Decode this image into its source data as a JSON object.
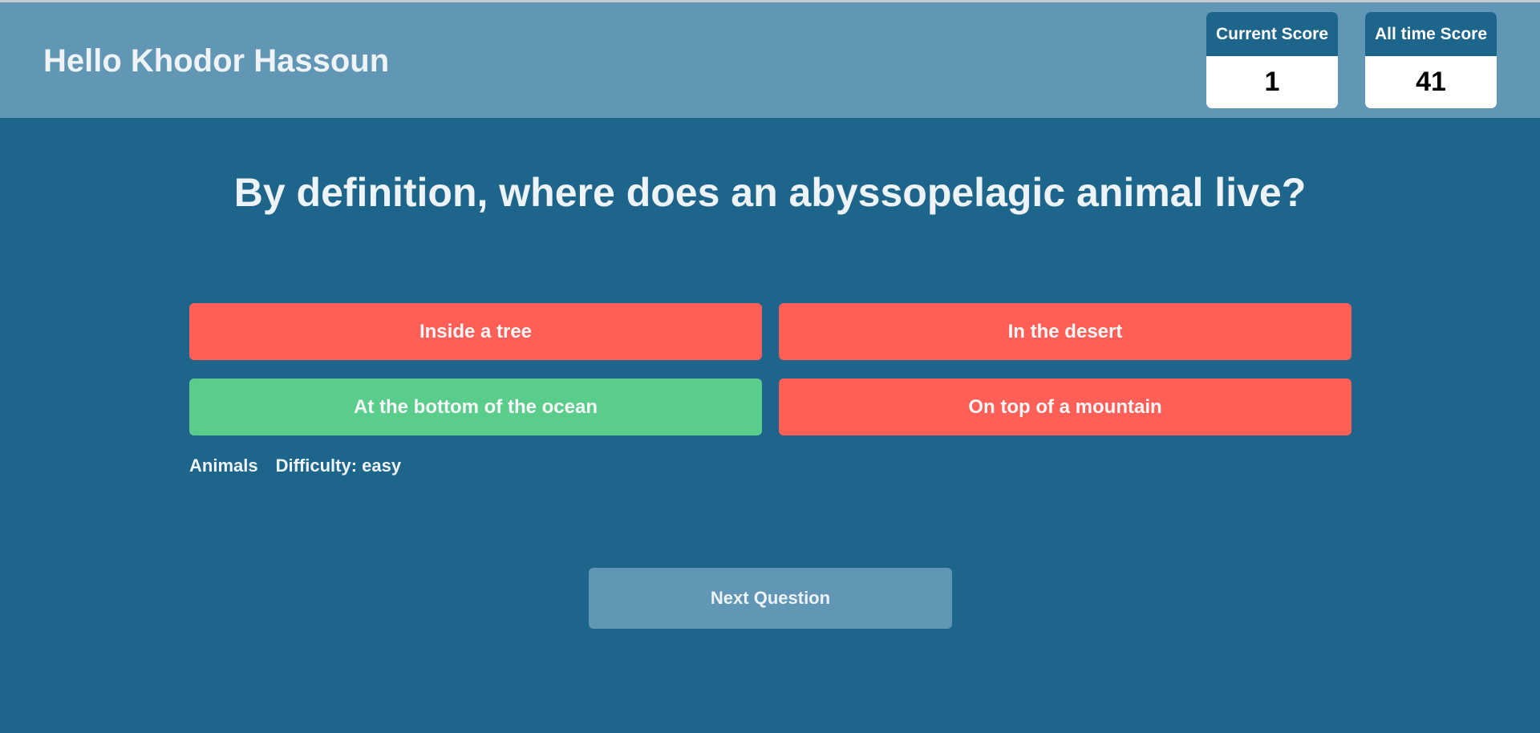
{
  "header": {
    "greeting": "Hello Khodor Hassoun",
    "scores": {
      "current_label": "Current Score",
      "current_value": "1",
      "alltime_label": "All time Score",
      "alltime_value": "41"
    }
  },
  "quiz": {
    "question": "By definition, where does an abyssopelagic animal live?",
    "answers": [
      {
        "label": "Inside a tree",
        "state": "wrong"
      },
      {
        "label": "In the desert",
        "state": "wrong"
      },
      {
        "label": "At the bottom of the ocean",
        "state": "correct"
      },
      {
        "label": "On top of a mountain",
        "state": "wrong"
      }
    ],
    "category": "Animals",
    "difficulty": "Difficulty: easy",
    "next_label": "Next Question"
  },
  "colors": {
    "page_background": "#1e658c",
    "header_background": "#6196b5",
    "wrong_answer": "#ff5f57",
    "correct_answer": "#5acc8c",
    "text": "#eef3f7"
  }
}
